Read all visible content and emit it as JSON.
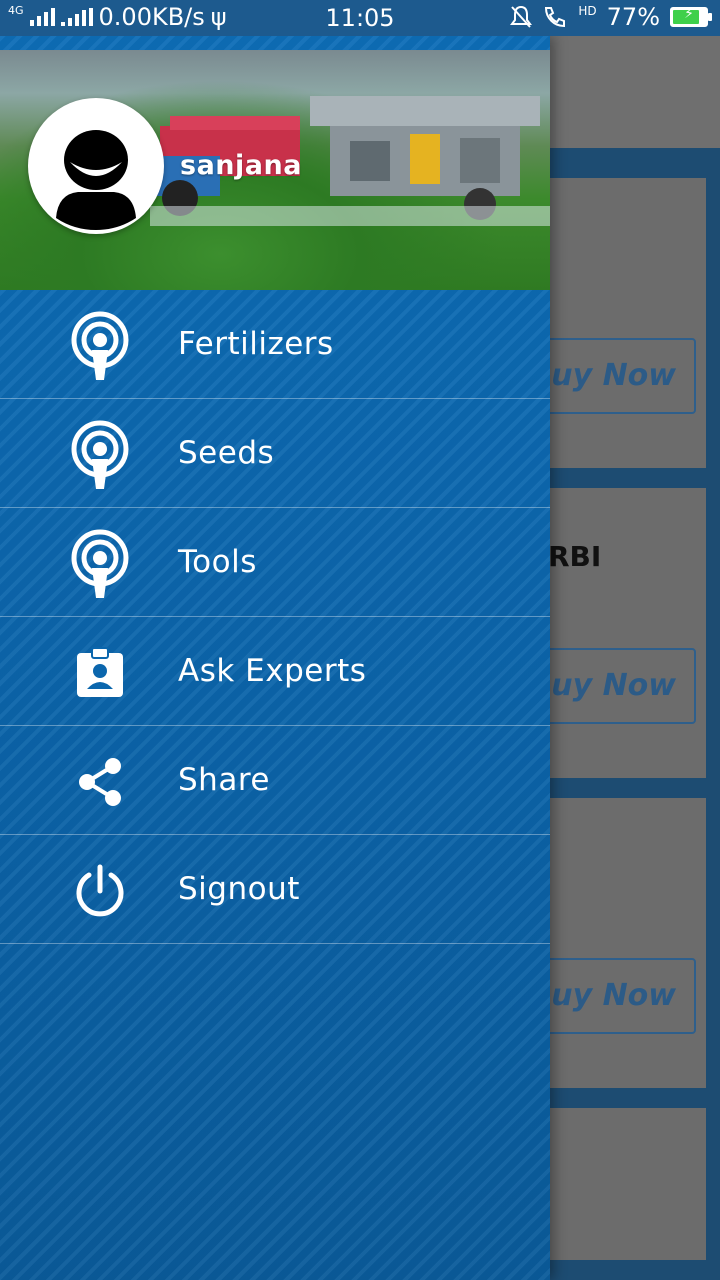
{
  "status_bar": {
    "network": "4G",
    "speed": "0.00KB/s",
    "time": "11:05",
    "hd": "HD",
    "battery_percent": "77%",
    "battery_level": 0.77
  },
  "drawer": {
    "username": "sanjana",
    "menu": [
      {
        "label": "Fertilizers",
        "icon": "podcast-icon"
      },
      {
        "label": "Seeds",
        "icon": "podcast-icon"
      },
      {
        "label": "Tools",
        "icon": "podcast-icon"
      },
      {
        "label": "Ask Experts",
        "icon": "id-badge-icon"
      },
      {
        "label": "Share",
        "icon": "share-icon"
      },
      {
        "label": "Signout",
        "icon": "power-icon"
      }
    ]
  },
  "background": {
    "buy_label": "Buy Now",
    "card_label": "RBI"
  },
  "colors": {
    "drawer": "#0b66ad",
    "status_bar": "#1d5a8e",
    "battery": "#3fd04a"
  }
}
